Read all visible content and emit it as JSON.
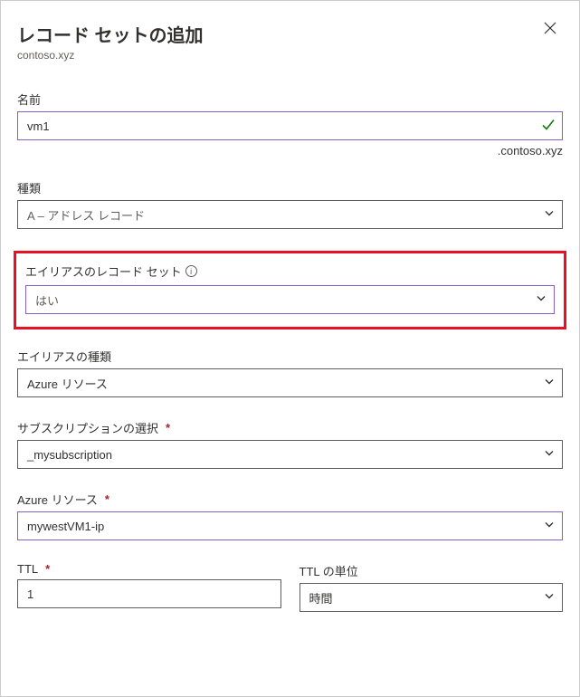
{
  "header": {
    "title": "レコード セットの追加",
    "subtitle": "contoso.xyz"
  },
  "fields": {
    "name": {
      "label": "名前",
      "value": "vm1",
      "suffix": ".contoso.xyz"
    },
    "type": {
      "label": "種類",
      "value": "A – アドレス レコード"
    },
    "alias_record_set": {
      "label": "エイリアスのレコード セット",
      "value": "はい"
    },
    "alias_type": {
      "label": "エイリアスの種類",
      "value": "Azure リソース"
    },
    "subscription": {
      "label": "サブスクリプションの選択",
      "value": "_mysubscription"
    },
    "azure_resource": {
      "label": "Azure リソース",
      "value": "mywestVM1-ip"
    },
    "ttl": {
      "label": "TTL",
      "value": "1"
    },
    "ttl_unit": {
      "label": "TTL の単位",
      "value": "時間"
    }
  },
  "required_mark": "*"
}
